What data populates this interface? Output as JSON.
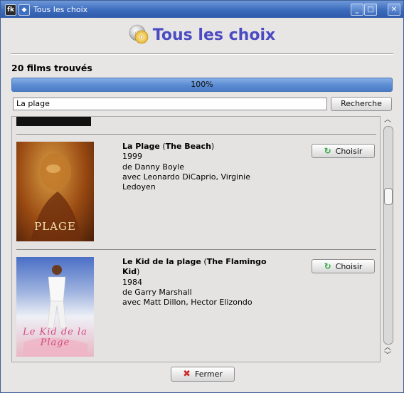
{
  "window": {
    "title": "Tous les choix",
    "app_icon": "app-logo-icon",
    "menu_icon": "window-menu-icon",
    "minimize_glyph": "_",
    "maximize_glyph": "□",
    "close_glyph": "✕"
  },
  "header": {
    "title": "Tous les choix",
    "icon": "disc-icon"
  },
  "results": {
    "count_text": "20 films trouvés",
    "progress_text": "100%",
    "progress_value": 1.0
  },
  "search": {
    "value": "La plage",
    "button_label": "Recherche"
  },
  "films": [
    {
      "title": "La Plage",
      "original_title": "The Beach",
      "year": "1999",
      "director": "de Danny Boyle",
      "cast": "avec Leonardo DiCaprio, Virginie Ledoyen",
      "poster_text": "PLAGE",
      "choose_label": "Choisir"
    },
    {
      "title": "Le Kid de la plage",
      "original_title": "The Flamingo Kid",
      "year": "1984",
      "director": "de Garry Marshall",
      "cast": "avec Matt Dillon, Hector Elizondo",
      "poster_text": "Le Kid de la Plage",
      "choose_label": "Choisir"
    }
  ],
  "icons": {
    "choose": "refresh-arrow-icon",
    "close": "red-x-icon"
  },
  "footer": {
    "close_label": "Fermer"
  },
  "colors": {
    "title_accent": "#4b4bc2",
    "titlebar": "#3c6bbd",
    "progress": "#5a8bd2"
  }
}
